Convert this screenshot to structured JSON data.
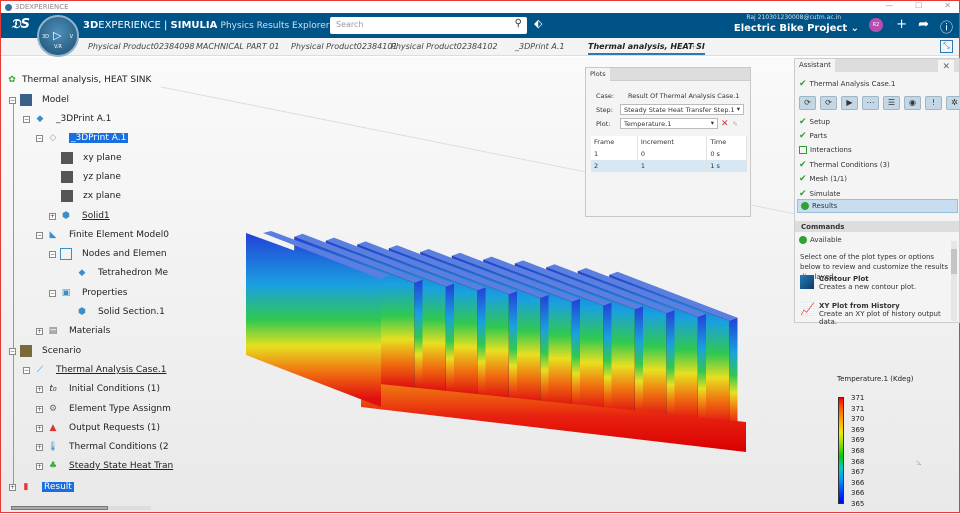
{
  "window": {
    "title": "3DEXPERIENCE",
    "min": "—",
    "max": "☐",
    "close": "✕"
  },
  "header": {
    "brand_bold": "3D",
    "brand_rest": "EXPERIENCE | ",
    "simulia": "SIMULIA",
    "app": "Physics Results Explorer",
    "search_placeholder": "Search",
    "user": "Raj 210301230008@cutm.ac.in",
    "project": "Electric Bike Project ⌄",
    "avatar": "R2",
    "compass_version": "V.R",
    "compass_3d": "3D",
    "compass_v": "V"
  },
  "tabs": [
    {
      "label": "Physical Product02384098"
    },
    {
      "label": "MACHNICAL PART 01"
    },
    {
      "label": "Physical Product02384101"
    },
    {
      "label": "Physical Product02384102"
    },
    {
      "label": "_3DPrint A.1"
    },
    {
      "label": "Thermal analysis, HEAT SI"
    }
  ],
  "tree": {
    "root": "Thermal analysis, HEAT SINK",
    "model": "Model",
    "print1": "_3DPrint A.1",
    "print2": "_3DPrint A.1",
    "xy": "xy plane",
    "yz": "yz plane",
    "zx": "zx plane",
    "solid": "Solid1",
    "fem": "Finite Element Model0",
    "nodes": "Nodes and Elemen",
    "tetra": "Tetrahedron Me",
    "props": "Properties",
    "section": "Solid Section.1",
    "materials": "Materials",
    "scenario": "Scenario",
    "case": "Thermal Analysis Case.1",
    "initial": "Initial Conditions (1)",
    "elemtype": "Element Type Assignm",
    "output": "Output Requests (1)",
    "thermal": "Thermal Conditions (2",
    "steady": "Steady State Heat Tran",
    "result": "Result"
  },
  "plots": {
    "tab": "Plots",
    "case_label": "Case:",
    "case_value": "Result Of Thermal Analysis Case.1",
    "step_label": "Step:",
    "step_value": "Steady State Heat Transfer Step.1",
    "plot_label": "Plot:",
    "plot_value": "Temperature.1",
    "columns": [
      "Frame",
      "Increment",
      "Time"
    ],
    "rows": [
      [
        "1",
        "0",
        "0 s"
      ],
      [
        "2",
        "1",
        "1 s"
      ]
    ]
  },
  "assistant": {
    "tab": "Assistant",
    "case": "Thermal Analysis Case.1",
    "steps": [
      {
        "label": "Setup",
        "state": "done"
      },
      {
        "label": "Parts",
        "state": "done"
      },
      {
        "label": "Interactions",
        "state": "empty"
      },
      {
        "label": "Thermal Conditions (3)",
        "state": "done"
      },
      {
        "label": "Mesh (1/1)",
        "state": "done"
      },
      {
        "label": "Simulate",
        "state": "done"
      }
    ],
    "results": "Results",
    "commands": "Commands",
    "available": "Available",
    "description": "Select one of the plot types or options below to review and customize the results displayed.",
    "cmd1_title": "Contour Plot",
    "cmd1_desc": "Creates a new contour plot.",
    "cmd2_title": "XY Plot from History",
    "cmd2_desc": "Create an XY plot of history output data."
  },
  "legend": {
    "title": "Temperature.1 (Kdeg)",
    "ticks": [
      "371",
      "371",
      "370",
      "369",
      "369",
      "368",
      "368",
      "367",
      "366",
      "366",
      "365"
    ]
  },
  "colors": {
    "header": "#005386",
    "selection": "#1a6fe0",
    "check": "#2e9e2e"
  }
}
